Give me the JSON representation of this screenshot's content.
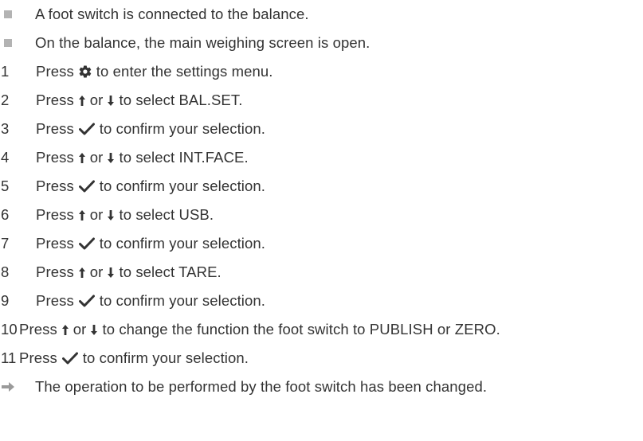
{
  "prerequisites": [
    "A foot switch is connected to the balance.",
    "On the balance, the main weighing screen is open."
  ],
  "steps": [
    {
      "n": "1",
      "before": "Press",
      "icon": "gear-icon",
      "after": "to enter the settings menu."
    },
    {
      "n": "2",
      "before": "Press",
      "icon": "up-down-arrows",
      "after": "to select  BAL.SET."
    },
    {
      "n": "3",
      "before": "Press",
      "icon": "check-icon",
      "after": "to confirm your selection."
    },
    {
      "n": "4",
      "before": "Press",
      "icon": "up-down-arrows",
      "after": "to select  INT.FACE."
    },
    {
      "n": "5",
      "before": "Press",
      "icon": "check-icon",
      "after": "to confirm your selection."
    },
    {
      "n": "6",
      "before": "Press",
      "icon": "up-down-arrows",
      "after": "to select USB."
    },
    {
      "n": "7",
      "before": "Press",
      "icon": "check-icon",
      "after": "to confirm your selection."
    },
    {
      "n": "8",
      "before": "Press",
      "icon": "up-down-arrows",
      "after": "to select TARE."
    },
    {
      "n": "9",
      "before": "Press",
      "icon": "check-icon",
      "after": "to confirm your selection."
    },
    {
      "n": "10",
      "before": "Press",
      "icon": "up-down-arrows",
      "after": "to change the function the foot switch to PUBLISH or ZERO."
    },
    {
      "n": "11",
      "before": "Press",
      "icon": "check-icon",
      "after": "to confirm your selection."
    }
  ],
  "connector_or": "or",
  "result": "The operation to be performed by the foot switch has been changed.",
  "colors": {
    "text": "#333333",
    "bullet": "#b3b3b3",
    "result_arrow": "#9a9a9a"
  }
}
